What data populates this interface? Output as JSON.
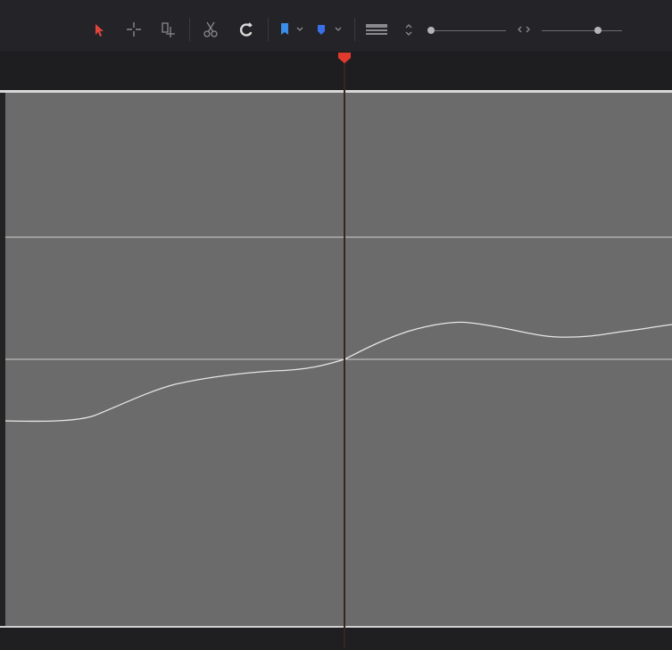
{
  "toolbar": {
    "tools": [
      {
        "name": "selection-tool",
        "icon": "arrow-pointer-icon",
        "color": "#e0443a",
        "active": true
      },
      {
        "name": "trim-tool",
        "icon": "crosshair-icon",
        "color": "#8a8a8e"
      },
      {
        "name": "dynamic-trim-tool",
        "icon": "blade-edit-icon",
        "color": "#8a8a8e"
      },
      {
        "name": "blade-tool",
        "icon": "scissors-icon",
        "color": "#8a8a8e"
      },
      {
        "name": "snapping-toggle",
        "icon": "magnet-icon",
        "color": "#d0d0d0"
      },
      {
        "name": "flag-dropdown",
        "icon": "flag-icon",
        "color": "#3a8ee6"
      },
      {
        "name": "marker-dropdown",
        "icon": "marker-icon",
        "color": "#3a6fe6"
      },
      {
        "name": "track-view-button",
        "icon": "track-lines-icon",
        "color": "#8a8a8e"
      },
      {
        "name": "track-height-button",
        "icon": "up-down-arrows-icon",
        "color": "#8a8a8e"
      },
      {
        "name": "zoom-button",
        "icon": "zoom-arrows-icon",
        "color": "#8a8a8e"
      }
    ],
    "track_height_level": 0.05,
    "zoom_level": 0.7
  },
  "playhead": {
    "color": "#e03a2e"
  },
  "graph": {
    "background": "#6b6b6b",
    "curve_color": "#e6e6e6",
    "gridline_color": "#cfcfcf"
  }
}
